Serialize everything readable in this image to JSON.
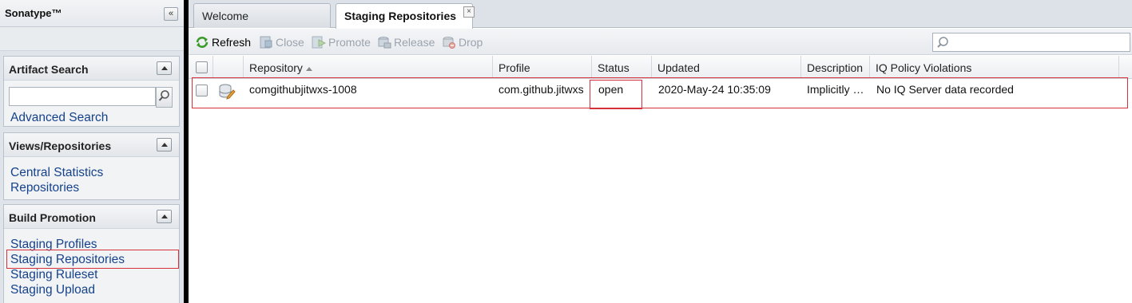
{
  "sidebar": {
    "brand": "Sonatype™",
    "collapse_icon": "«",
    "artifact_search": {
      "title": "Artifact Search",
      "search_value": "",
      "advanced_link": "Advanced Search"
    },
    "views": {
      "title": "Views/Repositories",
      "items": [
        {
          "label": "Central Statistics"
        },
        {
          "label": "Repositories"
        }
      ]
    },
    "build_promotion": {
      "title": "Build Promotion",
      "items": [
        {
          "label": "Staging Profiles"
        },
        {
          "label": "Staging Repositories"
        },
        {
          "label": "Staging Ruleset"
        },
        {
          "label": "Staging Upload"
        }
      ]
    }
  },
  "tabs": [
    {
      "label": "Welcome"
    },
    {
      "label": "Staging Repositories"
    }
  ],
  "tab_close_glyph": "×",
  "toolbar": {
    "refresh": "Refresh",
    "close": "Close",
    "promote": "Promote",
    "release": "Release",
    "drop": "Drop",
    "filter_value": ""
  },
  "grid": {
    "columns": [
      "Repository",
      "Profile",
      "Status",
      "Updated",
      "Description",
      "IQ Policy Violations"
    ],
    "rows": [
      {
        "repository": "comgithubjitwxs-1008",
        "profile": "com.github.jitwxs",
        "status": "open",
        "updated": "2020-May-24 10:35:09",
        "description": "Implicitly …",
        "iq": "No IQ Server data recorded"
      }
    ]
  },
  "colors": {
    "link": "#15428b",
    "highlight": "#d6303a",
    "disabled": "#9ba3ad"
  }
}
